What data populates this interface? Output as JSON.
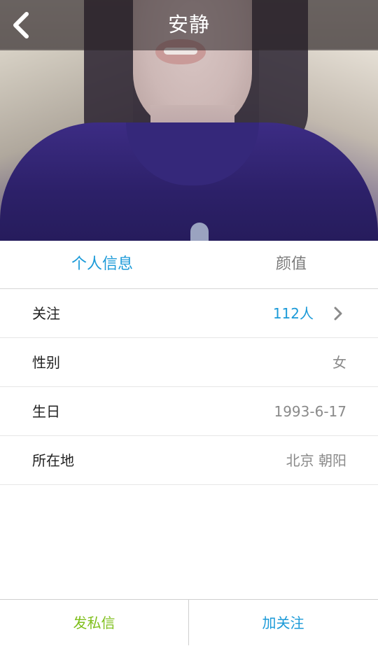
{
  "header": {
    "title": "安静",
    "back_icon": "chevron-left-icon"
  },
  "tabs": [
    {
      "label": "个人信息",
      "active": true
    },
    {
      "label": "颜值",
      "active": false
    }
  ],
  "info": {
    "follow": {
      "label": "关注",
      "value": "112人"
    },
    "gender": {
      "label": "性别",
      "value": "女"
    },
    "birthday": {
      "label": "生日",
      "value": "1993-6-17"
    },
    "location": {
      "label": "所在地",
      "value": "北京 朝阳"
    }
  },
  "actions": {
    "message_label": "发私信",
    "follow_label": "加关注"
  },
  "colors": {
    "accent_blue": "#1b9ad8",
    "accent_green": "#7fbf1c",
    "label_text": "#222222",
    "value_text": "#8a8a8a"
  }
}
